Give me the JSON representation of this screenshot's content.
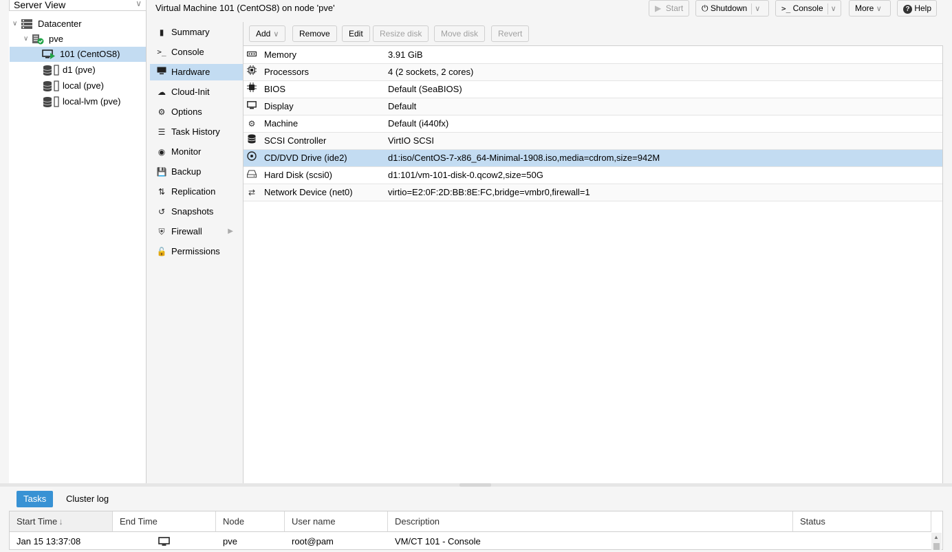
{
  "tree": {
    "view_label": "Server View",
    "items": [
      {
        "label": "Datacenter"
      },
      {
        "label": "pve"
      },
      {
        "label": "101 (CentOS8)"
      },
      {
        "label": "d1 (pve)"
      },
      {
        "label": "local (pve)"
      },
      {
        "label": "local-lvm (pve)"
      }
    ]
  },
  "header": {
    "title": "Virtual Machine 101 (CentOS8) on node 'pve'",
    "buttons": {
      "start": "Start",
      "shutdown": "Shutdown",
      "console": "Console",
      "more": "More",
      "help": "Help"
    }
  },
  "nav": {
    "items": [
      {
        "label": "Summary"
      },
      {
        "label": "Console"
      },
      {
        "label": "Hardware"
      },
      {
        "label": "Cloud-Init"
      },
      {
        "label": "Options"
      },
      {
        "label": "Task History"
      },
      {
        "label": "Monitor"
      },
      {
        "label": "Backup"
      },
      {
        "label": "Replication"
      },
      {
        "label": "Snapshots"
      },
      {
        "label": "Firewall"
      },
      {
        "label": "Permissions"
      }
    ],
    "selected": "Hardware"
  },
  "toolbar": {
    "add": "Add",
    "remove": "Remove",
    "edit": "Edit",
    "resize_disk": "Resize disk",
    "move_disk": "Move disk",
    "revert": "Revert"
  },
  "hardware": [
    {
      "icon": "memory-icon",
      "name": "Memory",
      "value": "3.91 GiB"
    },
    {
      "icon": "cpu-icon",
      "name": "Processors",
      "value": "4 (2 sockets, 2 cores)"
    },
    {
      "icon": "chip-icon",
      "name": "BIOS",
      "value": "Default (SeaBIOS)"
    },
    {
      "icon": "monitor-icon",
      "name": "Display",
      "value": "Default"
    },
    {
      "icon": "cogs-icon",
      "name": "Machine",
      "value": "Default (i440fx)"
    },
    {
      "icon": "database-icon",
      "name": "SCSI Controller",
      "value": "VirtIO SCSI"
    },
    {
      "icon": "cdrom-icon",
      "name": "CD/DVD Drive (ide2)",
      "value": "d1:iso/CentOS-7-x86_64-Minimal-1908.iso,media=cdrom,size=942M"
    },
    {
      "icon": "hdd-icon",
      "name": "Hard Disk (scsi0)",
      "value": "d1:101/vm-101-disk-0.qcow2,size=50G"
    },
    {
      "icon": "exchange-icon",
      "name": "Network Device (net0)",
      "value": "virtio=E2:0F:2D:BB:8E:FC,bridge=vmbr0,firewall=1"
    }
  ],
  "bottom": {
    "tabs": [
      {
        "label": "Tasks"
      },
      {
        "label": "Cluster log"
      }
    ],
    "columns": [
      "Start Time",
      "End Time",
      "Node",
      "User name",
      "Description",
      "Status"
    ],
    "sort_indicator": "↓",
    "rows": [
      {
        "start": "Jan 15 13:37:08",
        "end": "",
        "node": "pve",
        "user": "root@pam",
        "description": "VM/CT 101 - Console",
        "status": ""
      }
    ]
  },
  "colors": {
    "selected_bg": "#c3dcf2",
    "active_tab": "#3892d4",
    "status_ok": "#21a347",
    "running": "#21a347"
  }
}
